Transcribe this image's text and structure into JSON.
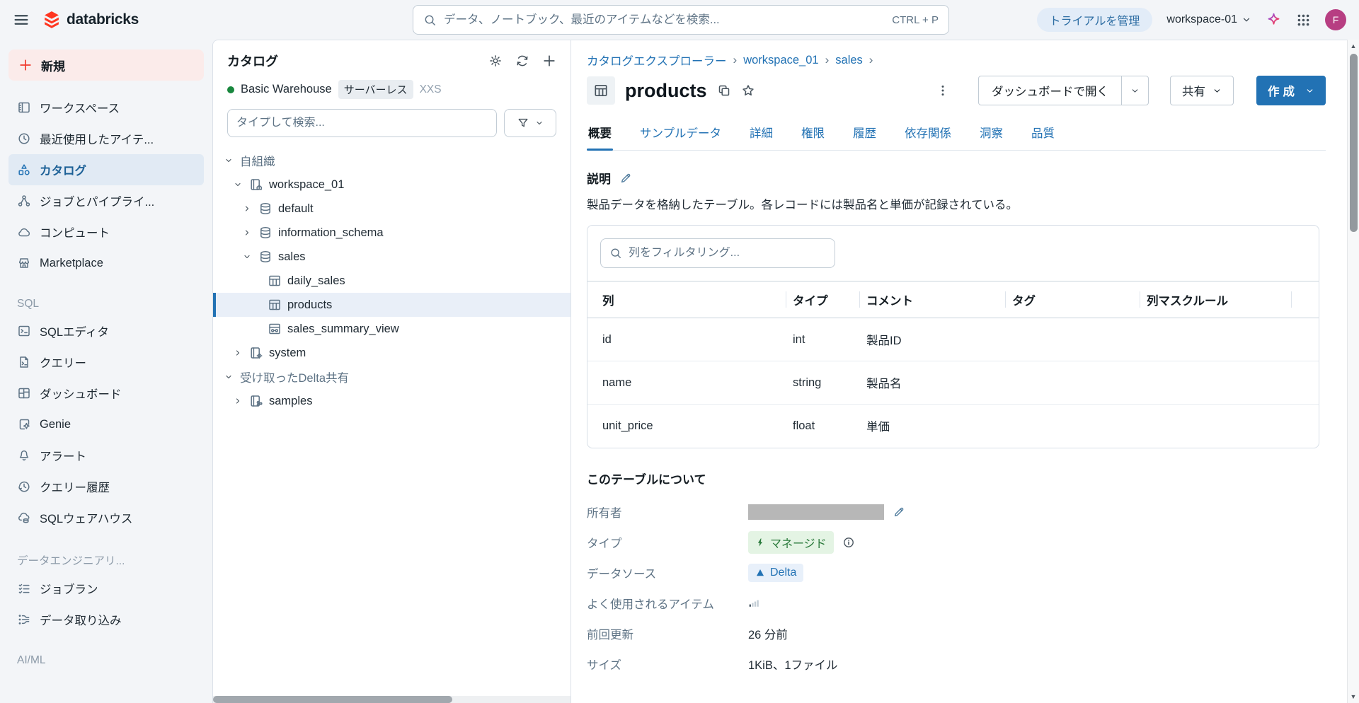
{
  "topbar": {
    "logo_text": "databricks",
    "search": {
      "placeholder": "データ、ノートブック、最近のアイテムなどを検索...",
      "shortcut": "CTRL + P"
    },
    "trial_label": "トライアルを管理",
    "workspace": "workspace-01",
    "avatar_initial": "F"
  },
  "sidebar": {
    "new_label": "新規",
    "items": [
      {
        "id": "workspace",
        "icon": "workspace",
        "label": "ワークスペース"
      },
      {
        "id": "recents",
        "icon": "clock",
        "label": "最近使用したアイテ..."
      },
      {
        "id": "catalog",
        "icon": "catalog",
        "label": "カタログ",
        "active": true
      },
      {
        "id": "jobs-pipelines",
        "icon": "pipelines",
        "label": "ジョブとパイプライ..."
      },
      {
        "id": "compute",
        "icon": "cloud",
        "label": "コンピュート"
      },
      {
        "id": "marketplace",
        "icon": "store",
        "label": "Marketplace"
      },
      {
        "section": "SQL"
      },
      {
        "id": "sql-editor",
        "icon": "sql-editor",
        "label": "SQLエディタ"
      },
      {
        "id": "queries",
        "icon": "queries",
        "label": "クエリー"
      },
      {
        "id": "dashboards",
        "icon": "dashboards",
        "label": "ダッシュボード"
      },
      {
        "id": "genie",
        "icon": "genie",
        "label": "Genie"
      },
      {
        "id": "alerts",
        "icon": "bell",
        "label": "アラート"
      },
      {
        "id": "query-history",
        "icon": "history",
        "label": "クエリー履歴"
      },
      {
        "id": "sql-warehouses",
        "icon": "warehouse",
        "label": "SQLウェアハウス"
      },
      {
        "section": "データエンジニアリ..."
      },
      {
        "id": "job-runs",
        "icon": "job-runs",
        "label": "ジョブラン"
      },
      {
        "id": "data-ingestion",
        "icon": "ingest",
        "label": "データ取り込み"
      },
      {
        "section": "AI/ML"
      }
    ]
  },
  "catalog": {
    "title": "カタログ",
    "warehouse": {
      "name": "Basic Warehouse",
      "badge": "サーバーレス",
      "size": "XXS"
    },
    "search_placeholder": "タイプして検索...",
    "tree": [
      {
        "depth": 0,
        "chevron": "down",
        "icon": null,
        "label": "自組織",
        "muted": true
      },
      {
        "depth": 1,
        "chevron": "down",
        "icon": "catalog-home",
        "label": "workspace_01"
      },
      {
        "depth": 2,
        "chevron": "right",
        "icon": "schema",
        "label": "default"
      },
      {
        "depth": 2,
        "chevron": "right",
        "icon": "schema",
        "label": "information_schema"
      },
      {
        "depth": 2,
        "chevron": "down",
        "icon": "schema",
        "label": "sales"
      },
      {
        "depth": 3,
        "chevron": "none",
        "icon": "table",
        "label": "daily_sales"
      },
      {
        "depth": 3,
        "chevron": "none",
        "icon": "table",
        "label": "products",
        "selected": true
      },
      {
        "depth": 3,
        "chevron": "none",
        "icon": "view",
        "label": "sales_summary_view"
      },
      {
        "depth": 1,
        "chevron": "right",
        "icon": "catalog-gear",
        "label": "system"
      },
      {
        "depth": 0,
        "chevron": "down",
        "icon": null,
        "label": "受け取ったDelta共有",
        "muted": true
      },
      {
        "depth": 1,
        "chevron": "right",
        "icon": "catalog-share",
        "label": "samples"
      }
    ]
  },
  "main": {
    "breadcrumbs": [
      "カタログエクスプローラー",
      "workspace_01",
      "sales"
    ],
    "title": "products",
    "active_tab": 0,
    "tabs": [
      "概要",
      "サンプルデータ",
      "詳細",
      "権限",
      "履歴",
      "依存関係",
      "洞察",
      "品質"
    ],
    "actions": {
      "open_dashboard": "ダッシュボードで開く",
      "share": "共有",
      "create": "作成"
    },
    "description_label": "説明",
    "description": "製品データを格納したテーブル。各レコードには製品名と単価が記録されている。",
    "columns": {
      "filter_placeholder": "列をフィルタリング...",
      "headers": [
        "列",
        "タイプ",
        "コメント",
        "タグ",
        "列マスクルール"
      ],
      "rows": [
        {
          "name": "id",
          "type": "int",
          "comment": "製品ID"
        },
        {
          "name": "name",
          "type": "string",
          "comment": "製品名"
        },
        {
          "name": "unit_price",
          "type": "float",
          "comment": "単価"
        }
      ]
    },
    "about": {
      "title": "このテーブルについて",
      "rows": [
        {
          "label": "所有者",
          "type": "redacted"
        },
        {
          "label": "タイプ",
          "type": "badge-managed",
          "value": "マネージド"
        },
        {
          "label": "データソース",
          "type": "badge-delta",
          "value": "Delta"
        },
        {
          "label": "よく使用されるアイテム",
          "type": "bars"
        },
        {
          "label": "前回更新",
          "type": "text",
          "value": "26 分前"
        },
        {
          "label": "サイズ",
          "type": "text",
          "value": "1KiB、1ファイル"
        }
      ]
    }
  },
  "colors": {
    "accent_blue": "#2272b4",
    "brand_red": "#ff3621",
    "green_status": "#19873e",
    "managed_pill_bg": "#e4f4e4",
    "delta_pill_bg": "#e8f0fa",
    "avatar_bg": "#b73e82",
    "selected_row_bg": "#e9eff8"
  }
}
